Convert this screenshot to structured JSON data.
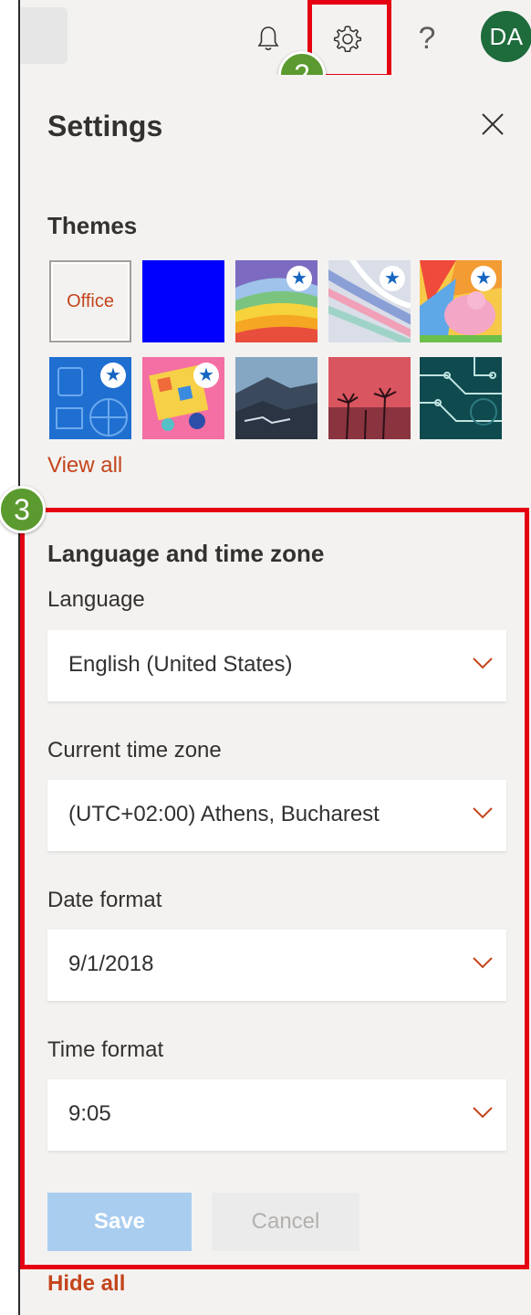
{
  "header": {
    "icons": [
      "bell-icon",
      "gear-icon",
      "help-icon"
    ],
    "help_glyph": "?",
    "avatar_initials": "DA",
    "avatar_color": "#1e6b3c"
  },
  "annotations": {
    "step2": "2",
    "step3": "3",
    "highlight_color": "#e50012",
    "badge_color": "#5b9a2f"
  },
  "settings": {
    "title": "Settings",
    "themes": {
      "heading": "Themes",
      "office_label": "Office",
      "view_all": "View all",
      "tiles": [
        {
          "name": "office",
          "featured": false
        },
        {
          "name": "blue",
          "featured": false
        },
        {
          "name": "rainbow-waves",
          "featured": true
        },
        {
          "name": "silver-ribbons",
          "featured": true
        },
        {
          "name": "unicorn",
          "featured": true
        },
        {
          "name": "sports",
          "featured": true
        },
        {
          "name": "board-game",
          "featured": true
        },
        {
          "name": "mountain",
          "featured": false
        },
        {
          "name": "palm-sunset",
          "featured": false
        },
        {
          "name": "circuit",
          "featured": false
        }
      ]
    },
    "language_time": {
      "heading": "Language and time zone",
      "language_label": "Language",
      "language_value": "English (United States)",
      "timezone_label": "Current time zone",
      "timezone_value": "(UTC+02:00) Athens, Bucharest",
      "date_format_label": "Date format",
      "date_format_value": "9/1/2018",
      "time_format_label": "Time format",
      "time_format_value": "9:05"
    },
    "save_label": "Save",
    "cancel_label": "Cancel",
    "hide_all": "Hide all",
    "accent_color": "#c4451c"
  }
}
